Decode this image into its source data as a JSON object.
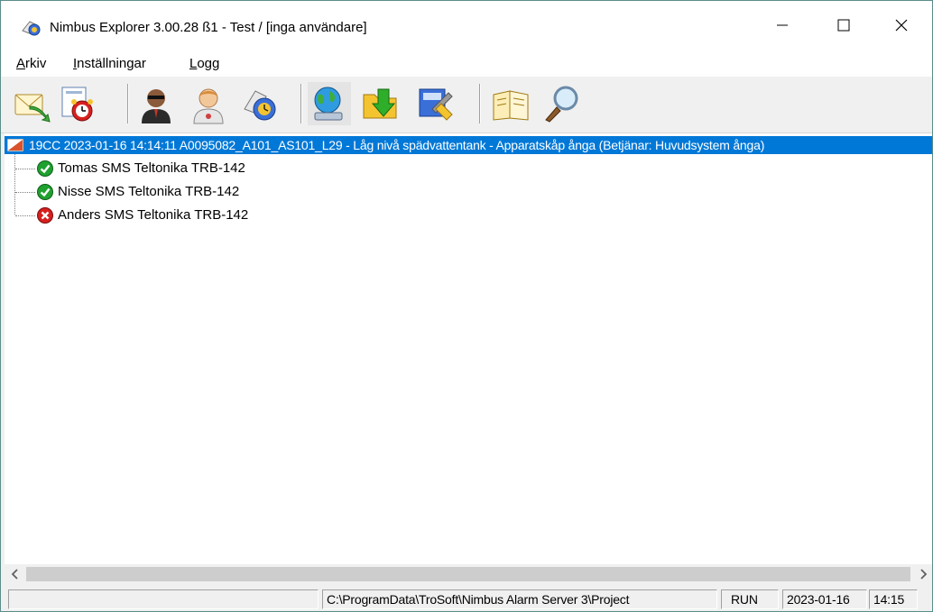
{
  "window": {
    "title": "Nimbus Explorer 3.00.28 ß1 - Test / [inga användare]",
    "icon": "app-icon"
  },
  "menu": [
    {
      "accel": "A",
      "rest": "rkiv"
    },
    {
      "accel": "I",
      "rest": "nställningar"
    },
    {
      "accel": "L",
      "rest": "ogg"
    }
  ],
  "toolbar": {
    "buttons": [
      "mail-icon",
      "alarm-clock-icon",
      "agent-icon",
      "user-icon",
      "clock-badge-icon",
      "globe-network-icon",
      "folder-download-icon",
      "settings-tools-icon",
      "book-icon",
      "magnifier-icon"
    ]
  },
  "tree": {
    "alarm": {
      "text": "19CC 2023-01-16 14:14:11 A0095082_A101_AS101_L29 - Låg nivå spädvattentank - Apparatskåp ånga (Betjänar: Huvudsystem ånga)"
    },
    "children": [
      {
        "label": "Tomas SMS Teltonika TRB-142",
        "status": "ok",
        "icon": "check-green-icon"
      },
      {
        "label": "Nisse SMS Teltonika TRB-142",
        "status": "ok",
        "icon": "check-green-icon"
      },
      {
        "label": "Anders SMS Teltonika TRB-142",
        "status": "error",
        "icon": "cross-red-icon"
      }
    ]
  },
  "statusbar": {
    "panel1": "",
    "path": "C:\\ProgramData\\TroSoft\\Nimbus Alarm Server 3\\Project",
    "state": "RUN",
    "date": "2023-01-16",
    "time": "14:15"
  },
  "colors": {
    "selection": "#0078d7",
    "ok": "#1fa12f",
    "error": "#d61f1f"
  }
}
